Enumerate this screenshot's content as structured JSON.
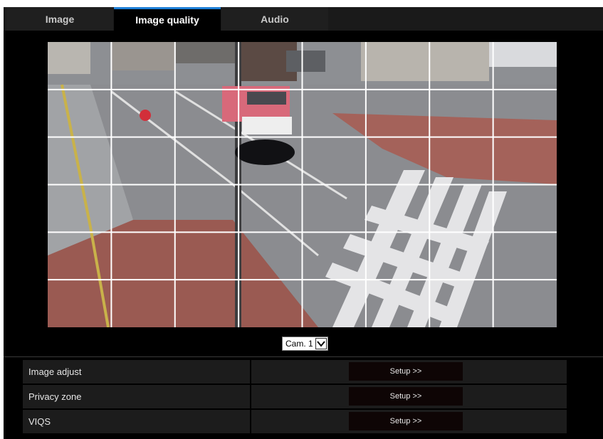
{
  "tabs": [
    {
      "label": "Image",
      "active": false
    },
    {
      "label": "Image quality",
      "active": true
    },
    {
      "label": "Audio",
      "active": false
    }
  ],
  "colors": {
    "accent": "#1e7fd6",
    "background": "#000000",
    "panel": "#1c1c1c"
  },
  "camera_select": {
    "value": "Cam. 1",
    "icon": "chevron-down-icon"
  },
  "settings": [
    {
      "label": "Image adjust",
      "button": "Setup >>"
    },
    {
      "label": "Privacy zone",
      "button": "Setup >>"
    },
    {
      "label": "VIQS",
      "button": "Setup >>"
    }
  ],
  "grid": {
    "columns": 8,
    "rows": 6
  }
}
